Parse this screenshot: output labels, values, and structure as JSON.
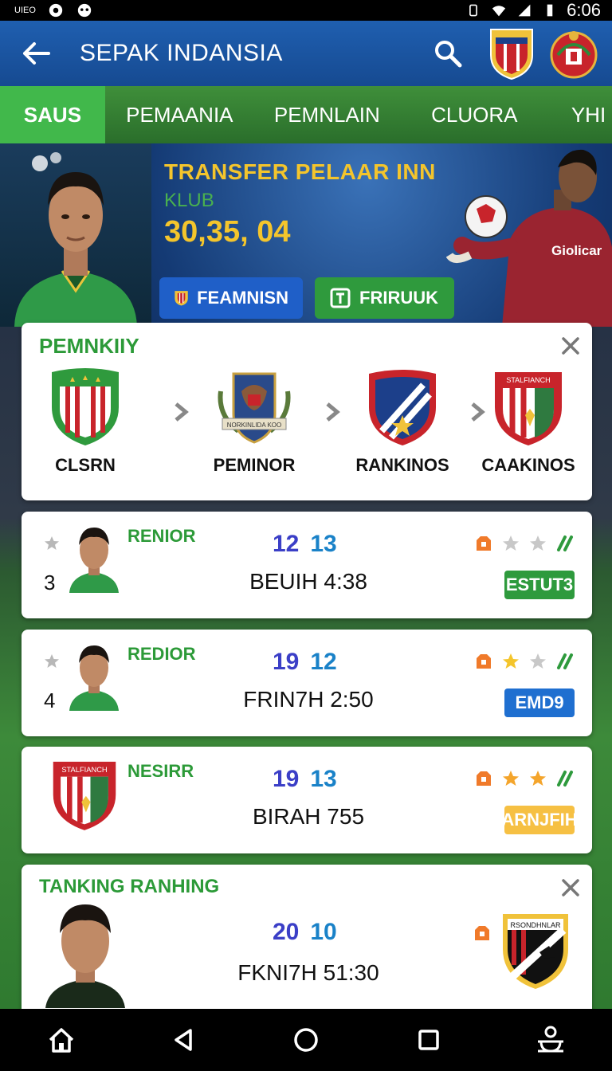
{
  "status_bar": {
    "time": "6:06",
    "left_label": "UIEO"
  },
  "app_bar": {
    "title": "SEPAK INDANSIA"
  },
  "tabs": [
    {
      "label": "SAUS",
      "active": true
    },
    {
      "label": "PEMAANIA",
      "active": false
    },
    {
      "label": "PEMNLAIN",
      "active": false
    },
    {
      "label": "CLUORA",
      "active": false
    },
    {
      "label": "YHI",
      "active": false
    }
  ],
  "hero": {
    "title": "TRANSFER PELAAR INN",
    "subtitle": "KLUB",
    "value": "30,35, 04",
    "btn_primary": "FEAMNISN",
    "btn_secondary": "FRIRUUK",
    "jersey_text": "Giolicar"
  },
  "pipeline_card": {
    "title": "PEMNKIIY",
    "steps": [
      {
        "label": "CLSRN"
      },
      {
        "label": "PEMINOR",
        "badge_text": "NORKINLIDA KOO"
      },
      {
        "label": "RANKINOS"
      },
      {
        "label": "CAAKINOS",
        "badge_text": "STALFIANCH"
      }
    ]
  },
  "rows": [
    {
      "rank": "3",
      "name": "RENIOR",
      "score_a": "12",
      "score_b": "13",
      "time": "BEUIH 4:38",
      "pill": "ESTUT3",
      "pill_color": "#2e9a3d"
    },
    {
      "rank": "4",
      "name": "REDIOR",
      "score_a": "19",
      "score_b": "12",
      "time": "FRIN7H 2:50",
      "pill": "EMD9",
      "pill_color": "#1f6fd0"
    },
    {
      "rank": "",
      "name": "NESIRR",
      "score_a": "19",
      "score_b": "13",
      "time": "BIRAH 755",
      "pill": "ARNJFIH",
      "pill_color": "#f6c043",
      "badge_text": "STALFIANCH"
    }
  ],
  "ranking_card": {
    "title": "TANKING RANHING",
    "score_a": "20",
    "score_b": "10",
    "time": "FKNI7H 51:30",
    "badge_text": "RSONDHNLAR"
  },
  "colors": {
    "appbar": "#1f5fb0",
    "tabs": "#2f7d30",
    "tab_active": "#41b84b",
    "accent_green": "#2c9a38",
    "accent_gold": "#f4c52c"
  }
}
